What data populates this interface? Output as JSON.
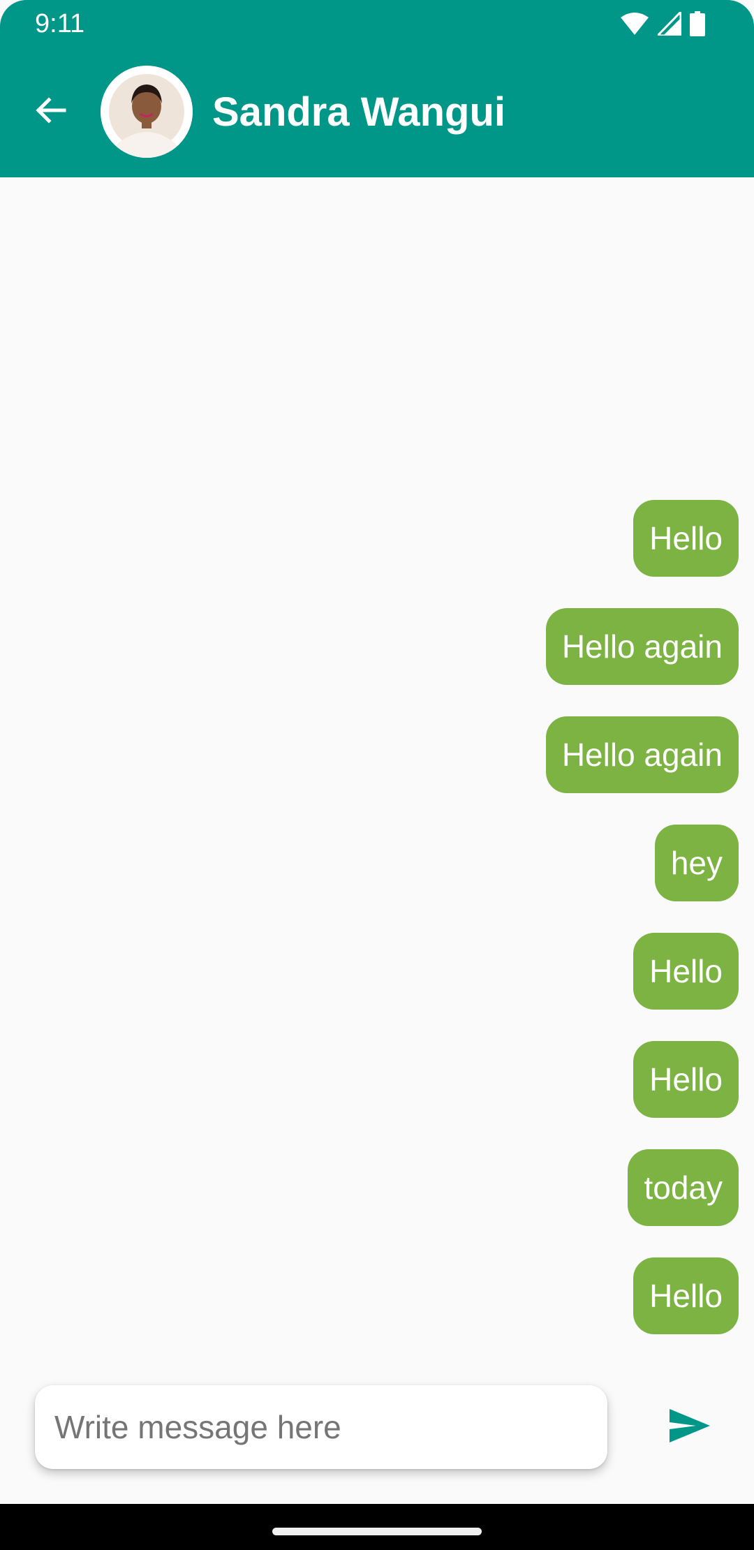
{
  "status_bar": {
    "time": "9:11",
    "icons": [
      "wifi-icon",
      "cellular-signal-icon",
      "battery-icon"
    ]
  },
  "header": {
    "back_icon": "arrow-back-icon",
    "contact_name": "Sandra Wangui",
    "avatar": "contact-avatar-photo"
  },
  "messages": [
    {
      "text": "Hello",
      "sender": "me"
    },
    {
      "text": "Hello again",
      "sender": "me"
    },
    {
      "text": "Hello again",
      "sender": "me"
    },
    {
      "text": "hey",
      "sender": "me"
    },
    {
      "text": "Hello",
      "sender": "me"
    },
    {
      "text": "Hello",
      "sender": "me"
    },
    {
      "text": "today",
      "sender": "me"
    },
    {
      "text": "Hello",
      "sender": "me"
    }
  ],
  "composer": {
    "placeholder": "Write message here",
    "value": "",
    "send_icon": "send-icon"
  },
  "colors": {
    "header": "#009688",
    "bubble": "#7cb342",
    "send_icon": "#009688",
    "background": "#fafafa"
  }
}
